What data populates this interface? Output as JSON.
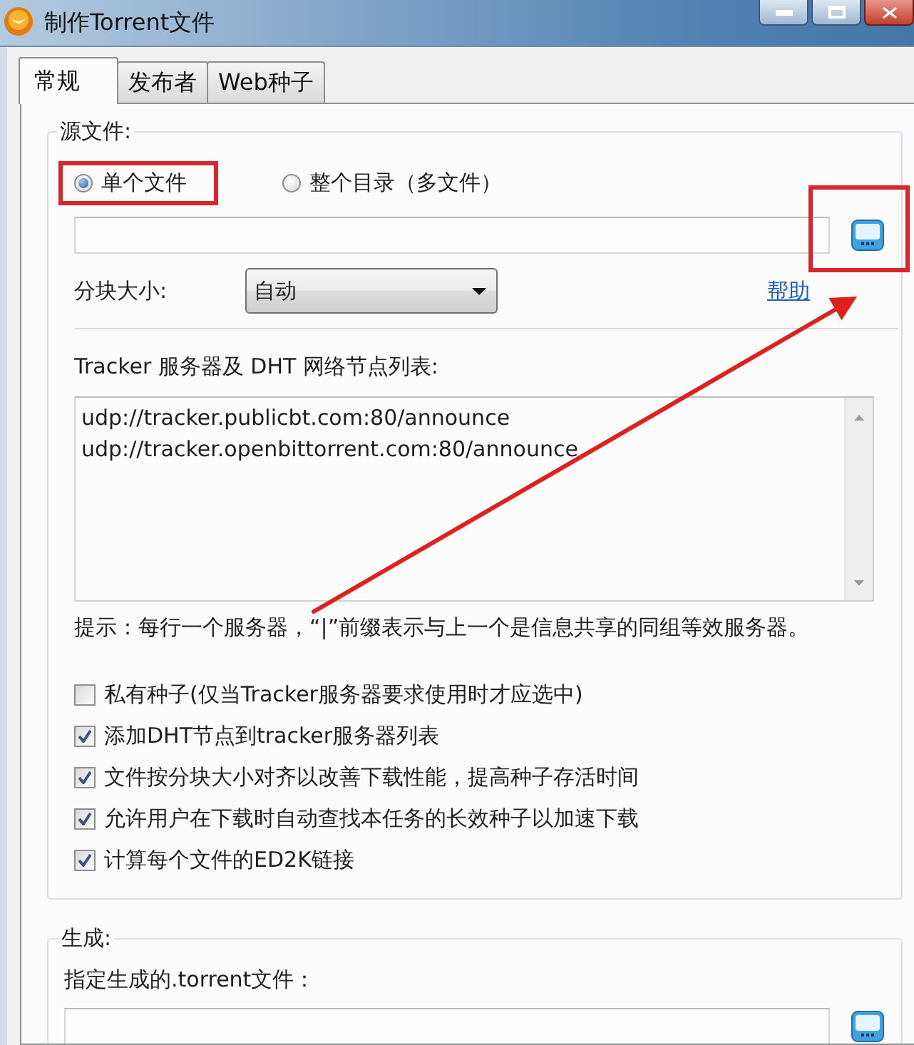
{
  "window": {
    "title": "制作Torrent文件"
  },
  "tabs": [
    {
      "label": "常规",
      "selected": true
    },
    {
      "label": "发布者",
      "selected": false
    },
    {
      "label": "Web种子",
      "selected": false
    }
  ],
  "source_files": {
    "legend": "源文件:",
    "modes": [
      {
        "label": "单个文件",
        "selected": true
      },
      {
        "label": "整个目录（多文件）",
        "selected": false
      }
    ],
    "piece_size": {
      "label": "分块大小:",
      "value": "自动"
    },
    "help_link": "帮助",
    "trackers": {
      "label": "Tracker 服务器及 DHT 网络节点列表:",
      "lines": [
        "udp://tracker.publicbt.com:80/announce",
        "udp://tracker.openbittorrent.com:80/announce"
      ]
    },
    "hint": "提示：每行一个服务器，“|”前缀表示与上一个是信息共享的同组等效服务器。",
    "options": [
      {
        "label": "私有种子(仅当Tracker服务器要求使用时才应选中)",
        "checked": false
      },
      {
        "label": "添加DHT节点到tracker服务器列表",
        "checked": true
      },
      {
        "label": "文件按分块大小对齐以改善下载性能，提高种子存活时间",
        "checked": true
      },
      {
        "label": "允许用户在下载时自动查找本任务的长效种子以加速下载",
        "checked": true
      },
      {
        "label": "计算每个文件的ED2K链接",
        "checked": true
      }
    ]
  },
  "output": {
    "legend": "生成:",
    "label": "指定生成的.torrent文件："
  }
}
